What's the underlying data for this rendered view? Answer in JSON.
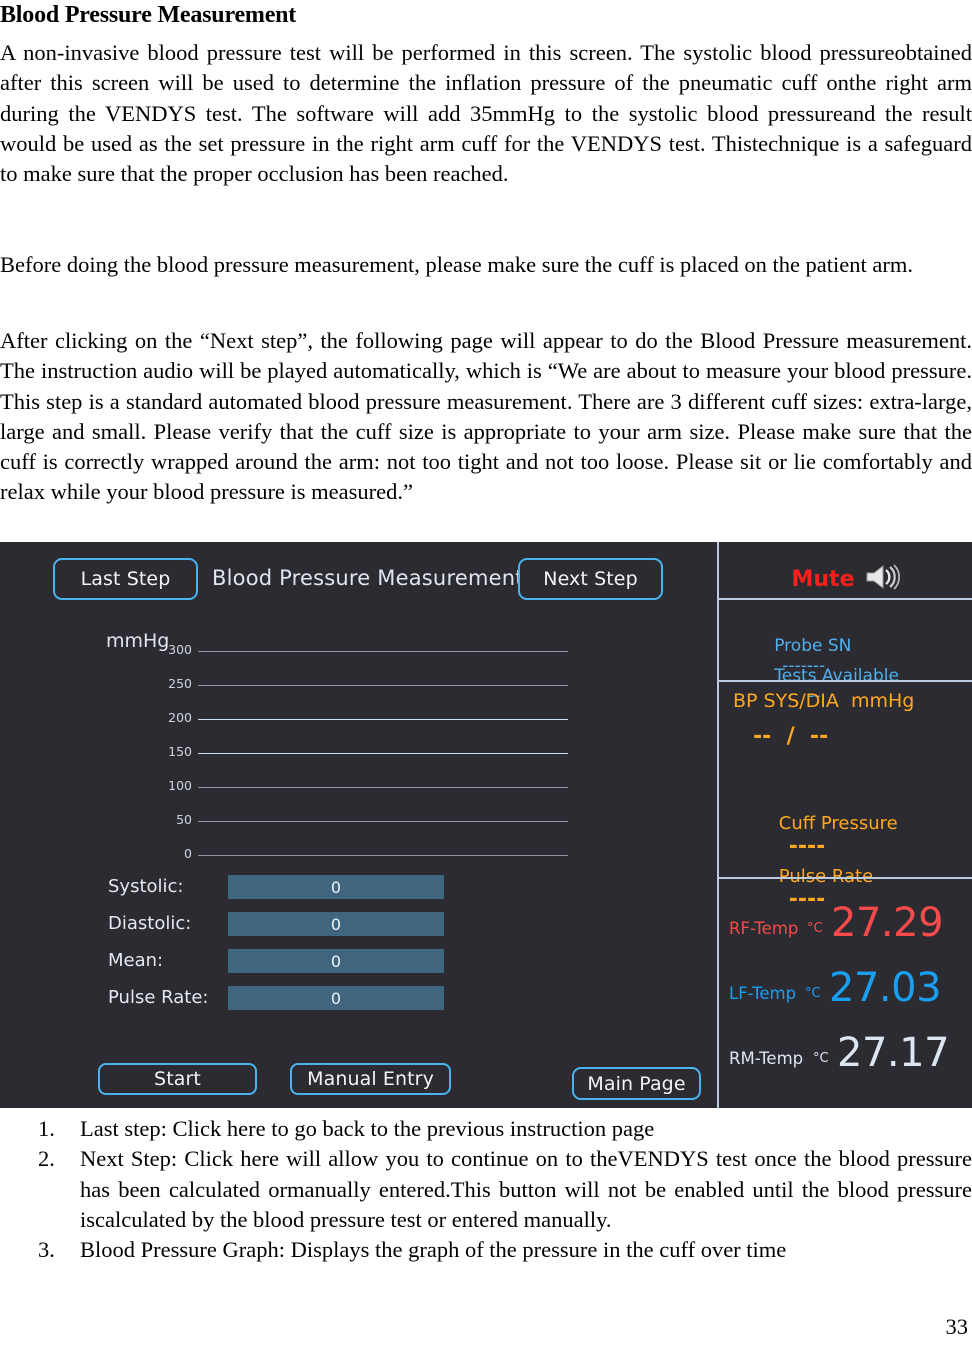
{
  "document": {
    "title": "Blood Pressure Measurement",
    "paragraphs": [
      "A non-invasive blood pressure test will be performed in this screen. The systolic blood pressureobtained after this screen will be used to determine the inflation pressure of the pneumatic cuff onthe right arm during the VENDYS test. The software will add 35mmHg to the systolic blood pressureand the result would be used as the set pressure in the right arm cuff for the VENDYS test. Thistechnique is a safeguard to make sure that the proper occlusion has been reached.",
      "Before doing the blood pressure measurement, please make sure the cuff is placed on the patient arm.",
      "After clicking on the “Next step”, the following page will appear to do the Blood Pressure measurement. The instruction audio will be played automatically, which is “We are about to measure your blood pressure. This step is a standard automated blood pressure measurement. There are 3 different cuff sizes: extra-large, large and small. Please verify that the cuff size is appropriate to your arm size. Please make sure that the cuff is correctly wrapped around the arm:  not too tight and not too loose. Please sit or lie comfortably and relax while your blood pressure is measured.”"
    ],
    "list": [
      {
        "num": "1.",
        "text": "Last step: Click here to go back to the previous instruction page"
      },
      {
        "num": "2.",
        "text": "Next Step: Click here will allow you to continue on to theVENDYS test once the blood pressure has been calculated ormanually entered.This button will not be enabled until the blood pressure iscalculated by the blood pressure test or entered manually."
      },
      {
        "num": "3.",
        "text": "Blood Pressure Graph: Displays the graph of the pressure in the cuff over time"
      }
    ],
    "page_number": "33"
  },
  "screenshot": {
    "header": {
      "last_step_label": "Last Step",
      "title": "Blood Pressure Measurement",
      "next_step_label": "Next Step"
    },
    "chart_data": {
      "type": "line",
      "title": "",
      "unit_label": "mmHg",
      "ylabel": "mmHg",
      "xlabel": "",
      "yticks": [
        "300",
        "250",
        "200",
        "150",
        "100",
        "50",
        "0"
      ],
      "ylim": [
        0,
        300
      ],
      "series": [
        {
          "name": "Cuff Pressure",
          "values": []
        }
      ],
      "grid": true,
      "legend": "none"
    },
    "readouts": [
      {
        "label": "Systolic:",
        "value": "0"
      },
      {
        "label": "Diastolic:",
        "value": "0"
      },
      {
        "label": "Mean:",
        "value": "0"
      },
      {
        "label": "Pulse Rate:",
        "value": "0"
      }
    ],
    "actions": {
      "start_label": "Start",
      "manual_entry_label": "Manual Entry",
      "main_page_label": "Main Page"
    },
    "right_panel": {
      "mute_label": "Mute",
      "speaker_icon": "speaker-icon",
      "probe_sn_label": "Probe SN",
      "probe_sn_value": "-------",
      "tests_available_label": "Tests Available",
      "tests_available_value": "--",
      "bp_header": "BP SYS/DIA  mmHg",
      "bp_value": "--  /  --",
      "cuff_pressure_label": "Cuff Pressure",
      "cuff_pressure_value": "----",
      "pulse_rate_label": "Pulse Rate",
      "pulse_rate_value": "----",
      "temps": [
        {
          "label": "RF-Temp",
          "unit": "°C",
          "value": "27.29",
          "color": "#f74a4a"
        },
        {
          "label": "LF-Temp",
          "unit": "°C",
          "value": "27.03",
          "color": "#1a9ff0"
        },
        {
          "label": "RM-Temp",
          "unit": "°C",
          "value": "27.17",
          "color": "#dce6f0"
        }
      ]
    },
    "colors": {
      "panel_bg": "#2b2b31",
      "accent_blue": "#4ab3ef",
      "amber": "#ffa81f",
      "field_bg": "#40667f",
      "mute_red": "#ff1e1e"
    }
  }
}
